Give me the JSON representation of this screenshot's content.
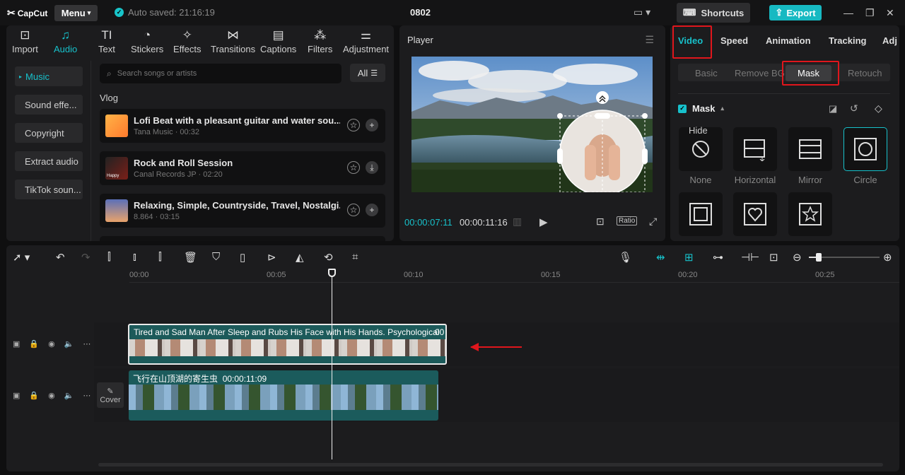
{
  "titlebar": {
    "logo": "CapCut",
    "menu_label": "Menu",
    "autosave": "Auto saved: 21:16:19",
    "project_name": "0802",
    "shortcuts_label": "Shortcuts",
    "export_label": "Export"
  },
  "media_tabs": [
    {
      "label": "Import",
      "icon": "import-icon"
    },
    {
      "label": "Audio",
      "icon": "audio-icon"
    },
    {
      "label": "Text",
      "icon": "text-icon"
    },
    {
      "label": "Stickers",
      "icon": "stickers-icon"
    },
    {
      "label": "Effects",
      "icon": "effects-icon"
    },
    {
      "label": "Transitions",
      "icon": "transitions-icon"
    },
    {
      "label": "Captions",
      "icon": "captions-icon"
    },
    {
      "label": "Filters",
      "icon": "filters-icon"
    },
    {
      "label": "Adjustment",
      "icon": "adjustment-icon"
    }
  ],
  "audio_sidebar": [
    "Music",
    "Sound effe...",
    "Copyright",
    "Extract audio",
    "TikTok soun..."
  ],
  "search": {
    "placeholder": "Search songs or artists",
    "filter_label": "All"
  },
  "section_title": "Vlog",
  "songs": [
    {
      "title": "Lofi Beat with a pleasant guitar and water sou...",
      "meta": "Tana Music · 00:32"
    },
    {
      "title": "Rock and Roll Session",
      "meta": "Canal Records JP · 02:20",
      "thumb_text": "Happy"
    },
    {
      "title": "Relaxing, Simple, Countryside, Travel, Nostalgi...",
      "meta": "8.864 · 03:15"
    }
  ],
  "player": {
    "title": "Player",
    "current_time": "00:00:07:11",
    "total_time": "00:00:11:16",
    "ratio_label": "Ratio"
  },
  "props": {
    "tabs": [
      "Video",
      "Speed",
      "Animation",
      "Tracking",
      "Adj"
    ],
    "subtabs": [
      "Basic",
      "Remove BG",
      "Mask",
      "Retouch"
    ],
    "mask_title": "Mask",
    "tooltip": "Hide",
    "mask_options": [
      {
        "label": "None",
        "icon": "none-mask-icon"
      },
      {
        "label": "Horizontal",
        "icon": "horizontal-mask-icon"
      },
      {
        "label": "Mirror",
        "icon": "mirror-mask-icon"
      },
      {
        "label": "Circle",
        "icon": "circle-mask-icon"
      },
      {
        "label": "",
        "icon": "rectangle-mask-icon"
      },
      {
        "label": "",
        "icon": "heart-mask-icon"
      },
      {
        "label": "",
        "icon": "star-mask-icon"
      }
    ],
    "accent_color": "#17c1cb",
    "highlight_color": "#e0161c"
  },
  "timeline": {
    "ruler": [
      "00:00",
      "00:05",
      "00:10",
      "00:15",
      "00:20",
      "00:25"
    ],
    "clip1_label": "Tired and Sad Man After Sleep and Rubs His Face with His Hands. Psychological",
    "clip1_duration": "00",
    "clip2_label": "飞行在山顶湖的寄生虫",
    "clip2_duration": "00:00:11:09",
    "cover_label": "Cover"
  }
}
